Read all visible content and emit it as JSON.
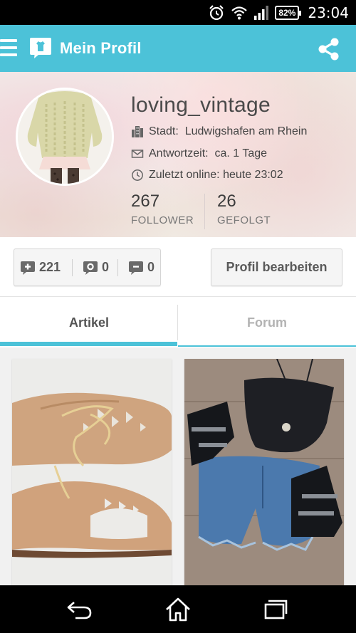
{
  "status_bar": {
    "time": "23:04",
    "battery": "82%",
    "icons": [
      "alarm-icon",
      "wifi-icon",
      "signal-icon",
      "battery-icon"
    ]
  },
  "app_bar": {
    "title": "Mein Profil",
    "icons": [
      "menu-icon",
      "app-logo-icon",
      "share-icon"
    ],
    "color": "#4cc2d8"
  },
  "profile": {
    "username": "loving_vintage",
    "city_label": "Stadt:",
    "city": "Ludwigshafen am Rhein",
    "response_label": "Antwortzeit:",
    "response": "ca. 1 Tage",
    "last_online_label": "Zuletzt online:",
    "last_online": "heute 23:02",
    "followers_count": "267",
    "followers_label": "FOLLOWER",
    "following_count": "26",
    "following_label": "GEFOLGT"
  },
  "actions": {
    "positive_count": "221",
    "neutral_count": "0",
    "negative_count": "0",
    "edit_label": "Profil bearbeiten"
  },
  "tabs": [
    {
      "label": "Artikel",
      "active": true
    },
    {
      "label": "Forum",
      "active": false
    }
  ],
  "items": [
    {
      "image": "beige-cutout-oxford-shoes"
    },
    {
      "image": "black-bustier-denim-shorts-boots"
    }
  ],
  "nav_bar": {
    "icons": [
      "back-icon",
      "home-icon",
      "recents-icon"
    ]
  }
}
